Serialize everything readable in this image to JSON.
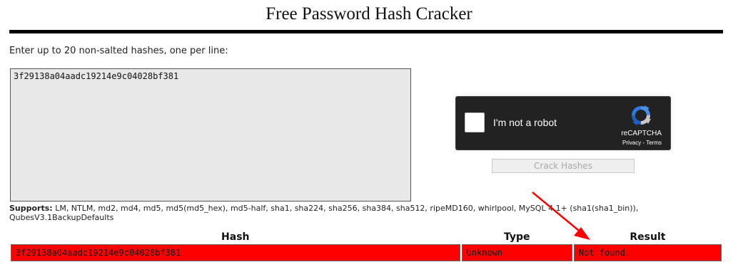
{
  "page": {
    "title": "Free Password Hash Cracker",
    "instructions": "Enter up to 20 non-salted hashes, one per line:"
  },
  "input": {
    "value": "3f29138a04aadc19214e9c04028bf381"
  },
  "recaptcha": {
    "label": "I'm not a robot",
    "brand": "reCAPTCHA",
    "privacy": "Privacy",
    "separator": " - ",
    "terms": "Terms",
    "logo_icon": "recaptcha-logo-icon"
  },
  "actions": {
    "crack_label": "Crack Hashes"
  },
  "supports": {
    "label": "Supports:",
    "text": " LM, NTLM, md2, md4, md5, md5(md5_hex), md5-half, sha1, sha224, sha256, sha384, sha512, ripeMD160, whirlpool, MySQL 4.1+ (sha1(sha1_bin)), QubesV3.1BackupDefaults"
  },
  "results": {
    "headers": [
      "Hash",
      "Type",
      "Result"
    ],
    "rows": [
      {
        "hash": "3f29138a04aadc19214e9c04028bf381",
        "type": "Unknown",
        "result": "Not found."
      }
    ]
  },
  "colors": {
    "result_row_bg": "#ff0000",
    "annotation_arrow": "#ff0000",
    "recaptcha_bg": "#222222"
  },
  "annotation": {
    "icon": "red-arrow-icon"
  }
}
